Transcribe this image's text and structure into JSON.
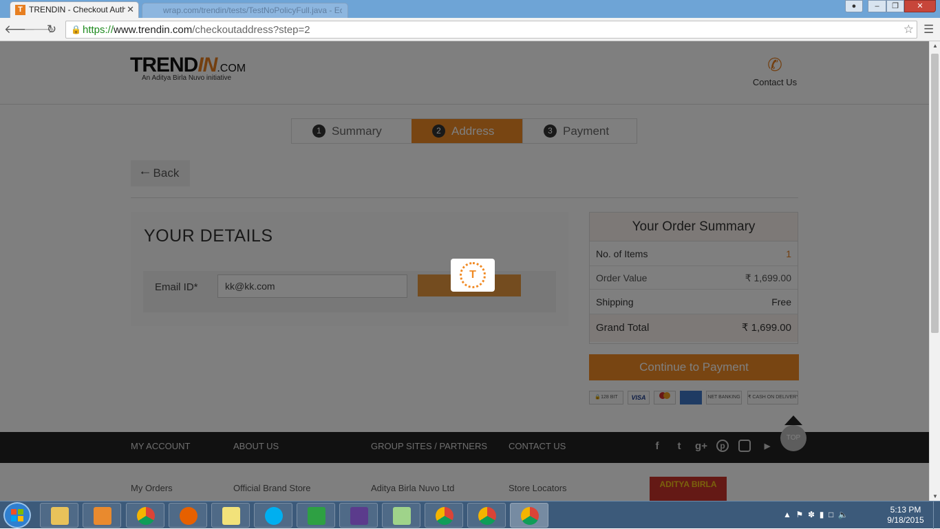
{
  "browser": {
    "tabs": [
      {
        "favicon": "T",
        "title": "TRENDIN - Checkout Authe",
        "close": "✕"
      },
      {
        "title": "wrap.com/trendin/tests/TestNoPolicyFull.java - Eclipse"
      }
    ],
    "url": {
      "scheme": "https://",
      "host": "www.trendin.com",
      "path": "/checkoutaddress?step=2"
    }
  },
  "header": {
    "logo": {
      "word_main": "TREND",
      "word_in": "IN",
      "word_com": ".COM",
      "tagline": "An Aditya Birla Nuvo initiative"
    },
    "contact_label": "Contact Us"
  },
  "steps": [
    {
      "num": "1",
      "label": "Summary"
    },
    {
      "num": "2",
      "label": "Address"
    },
    {
      "num": "3",
      "label": "Payment"
    }
  ],
  "back_label": "Back",
  "details": {
    "title": "YOUR DETAILS",
    "email_label": "Email ID*",
    "email_value": "kk@kk.com"
  },
  "order_summary": {
    "title": "Your Order Summary",
    "rows": [
      {
        "label": "No. of Items",
        "value": "1"
      },
      {
        "label": "Order Value",
        "value": "₹ 1,699.00"
      },
      {
        "label": "Shipping",
        "value": "Free"
      },
      {
        "label": "Grand Total",
        "value": "₹ 1,699.00"
      }
    ]
  },
  "continue_label": "Continue to Payment",
  "payment_badges": [
    "🔒128 BIT",
    "VISA",
    "",
    "",
    "NET BANKING",
    "₹ CASH ON DELIVERY"
  ],
  "top_label": "TOP",
  "footer": {
    "nav": [
      "MY ACCOUNT",
      "ABOUT US",
      "GROUP SITES / PARTNERS",
      "CONTACT US"
    ],
    "links": [
      "My Orders",
      "Official Brand Store",
      "Aditya Birla Nuvo Ltd",
      "Store Locators"
    ],
    "brand_logo_text": "ADITYA BIRLA"
  },
  "loader_glyph": "T",
  "taskbar": {
    "time": "5:13 PM",
    "date": "9/18/2015"
  },
  "colors": {
    "accent": "#f08a24",
    "footer_bg": "#222222"
  }
}
